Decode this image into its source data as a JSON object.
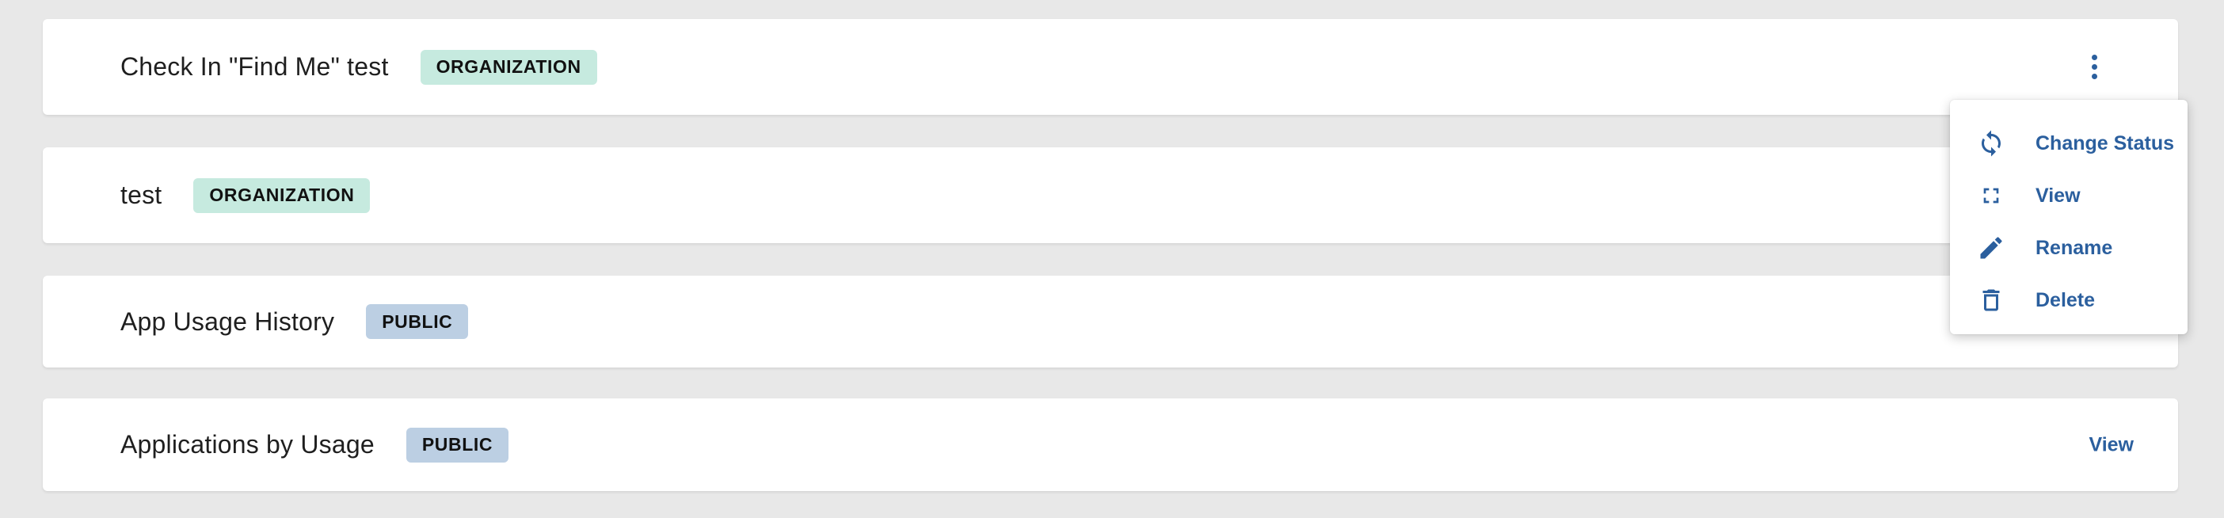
{
  "colors": {
    "page_bg": "#e8e8e8",
    "accent": "#2b5f9e",
    "badge_organization": "#c6eadf",
    "badge_public": "#bccfe3"
  },
  "items": [
    {
      "title": "Check In \"Find Me\" test",
      "badge": "ORGANIZATION",
      "badge_type": "organization",
      "action": "kebab-menu"
    },
    {
      "title": "test",
      "badge": "ORGANIZATION",
      "badge_type": "organization",
      "action": "none"
    },
    {
      "title": "App Usage History",
      "badge": "PUBLIC",
      "badge_type": "public",
      "action": "none"
    },
    {
      "title": "Applications by Usage",
      "badge": "PUBLIC",
      "badge_type": "public",
      "action": "view-link",
      "action_label": "View"
    }
  ],
  "context_menu": {
    "items": [
      {
        "label": "Change Status",
        "icon": "refresh-icon"
      },
      {
        "label": "View",
        "icon": "fullscreen-icon"
      },
      {
        "label": "Rename",
        "icon": "pencil-icon"
      },
      {
        "label": "Delete",
        "icon": "trash-icon"
      }
    ]
  }
}
